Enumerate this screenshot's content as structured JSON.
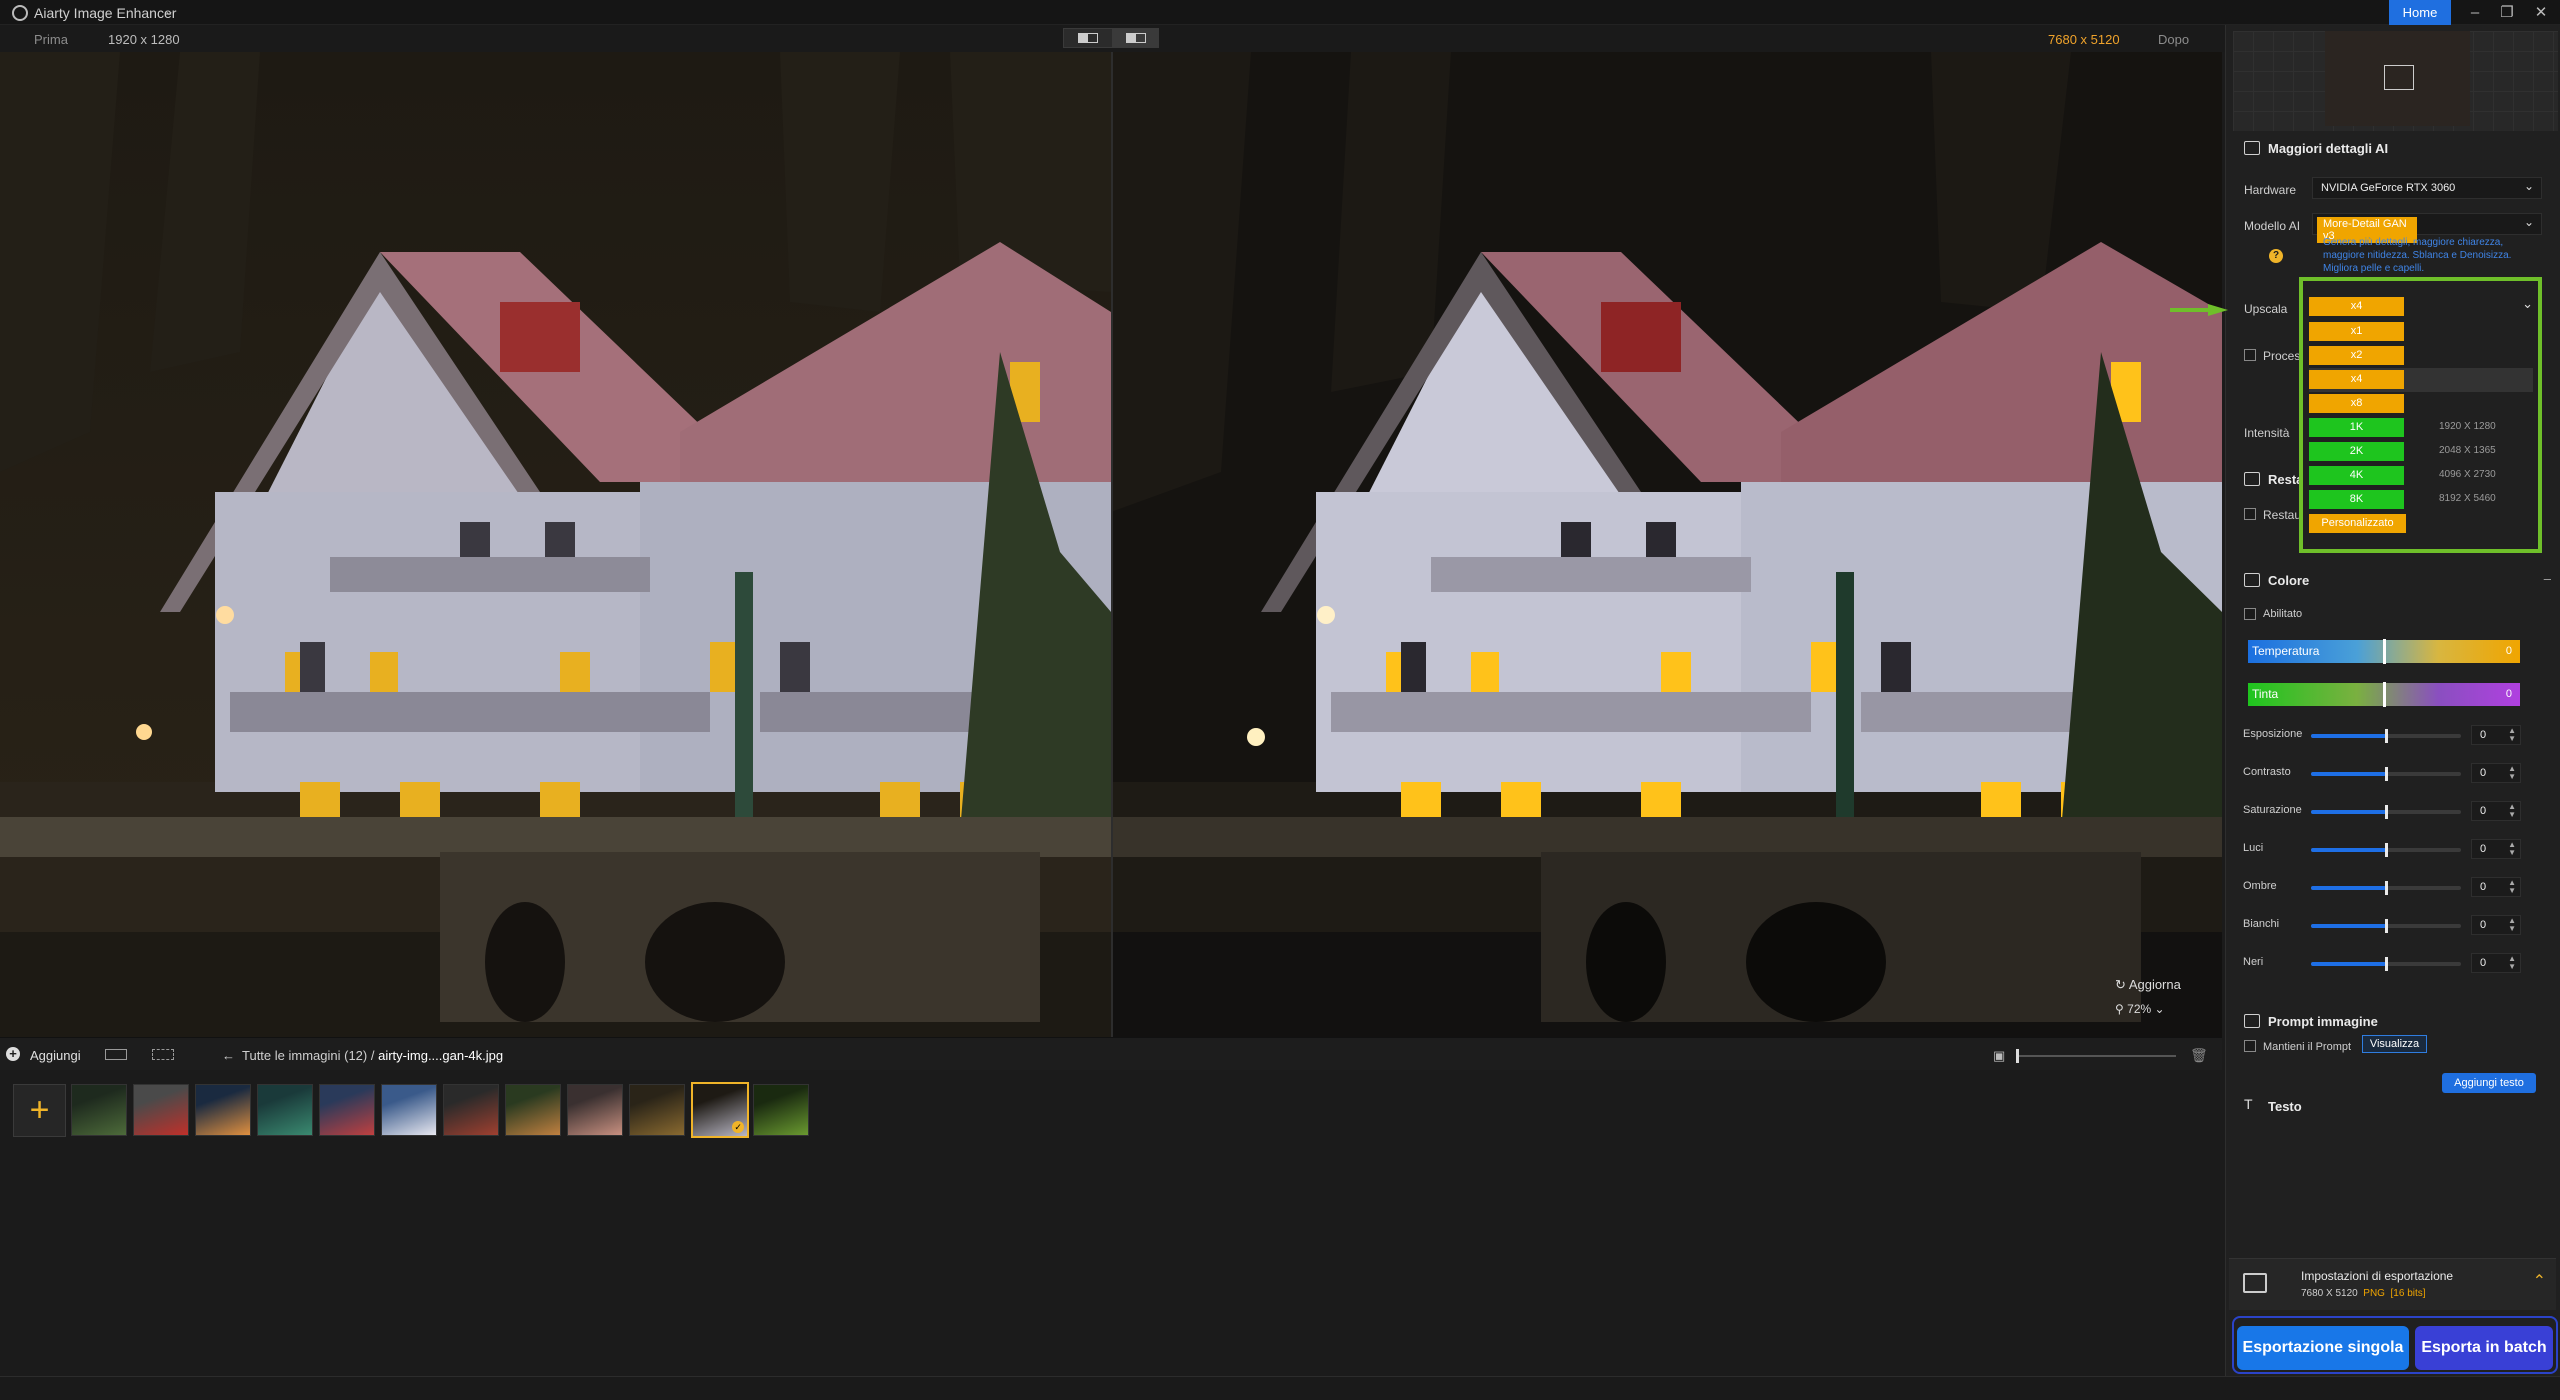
{
  "app": {
    "title": "Aiarty Image Enhancer",
    "home_label": "Home"
  },
  "compare": {
    "before_label": "Prima",
    "before_resolution": "1920 x 1280",
    "after_resolution": "7680 x 5120",
    "after_label": "Dopo"
  },
  "canvas": {
    "refresh_label": "Aggiorna",
    "zoom_level": "72%"
  },
  "bottom_bar": {
    "add_label": "Aggiungi",
    "breadcrumb_all": "Tutte le immagini (12)",
    "breadcrumb_sep": "/",
    "breadcrumb_file": "airty-img....gan-4k.jpg"
  },
  "thumbnails": {
    "count": 12,
    "selected_index": 10
  },
  "panel": {
    "section_ai": "Maggiori dettagli AI",
    "hardware_label": "Hardware",
    "hardware_value": "NVIDIA GeForce RTX 3060",
    "model_label": "Modello AI",
    "model_value": "More-Detail GAN  v3",
    "model_description": "Genera più dettagli, maggiore chiarezza, maggiore nitidezza. Sblanca e Denoisizza. Migliora pelle e capelli.",
    "upscale_label": "Upscala",
    "upscale_value": "x4",
    "process_label": "Processa",
    "intensity_label": "Intensità",
    "restore_section": "Restauro",
    "restore_label": "Restauro",
    "upscale_options": [
      {
        "label": "x1",
        "dim": ""
      },
      {
        "label": "x2",
        "dim": ""
      },
      {
        "label": "x4",
        "dim": ""
      },
      {
        "label": "x8",
        "dim": ""
      },
      {
        "label": "1K",
        "dim": "1920 X 1280"
      },
      {
        "label": "2K",
        "dim": "2048 X 1365"
      },
      {
        "label": "4K",
        "dim": "4096 X 2730"
      },
      {
        "label": "8K",
        "dim": "8192 X 5460"
      },
      {
        "label": "Personalizzato",
        "dim": ""
      }
    ],
    "color_section": "Colore",
    "enabled_label": "Abilitato",
    "temperature_label": "Temperatura",
    "temperature_value": "0",
    "tint_label": "Tinta",
    "tint_value": "0",
    "sliders": [
      {
        "label": "Esposizione",
        "value": "0",
        "level": 0.5
      },
      {
        "label": "Contrasto",
        "value": "0",
        "level": 0.5
      },
      {
        "label": "Saturazione",
        "value": "0",
        "level": 0.5
      },
      {
        "label": "Luci",
        "value": "0",
        "level": 0.5
      },
      {
        "label": "Ombre",
        "value": "0",
        "level": 0.5
      },
      {
        "label": "Bianchi",
        "value": "0",
        "level": 0.5
      },
      {
        "label": "Neri",
        "value": "0",
        "level": 0.5
      }
    ],
    "prompt_section": "Prompt immagine",
    "keep_prompt_label": "Mantieni il Prompt",
    "view_button": "Visualizza",
    "text_section": "Testo",
    "add_text_button": "Aggiungi testo",
    "export_title": "Impostazioni di esportazione",
    "export_size": "7680 X 5120",
    "export_format": "PNG",
    "export_bits": "[16 bits]",
    "export_single": "Esportazione singola",
    "export_batch": "Esporta in batch"
  },
  "colors": {
    "accent_blue": "#1f6fe0",
    "accent_orange": "#f0a500",
    "option_green": "#1ec51e",
    "highlight_green": "#6fbf2a"
  }
}
